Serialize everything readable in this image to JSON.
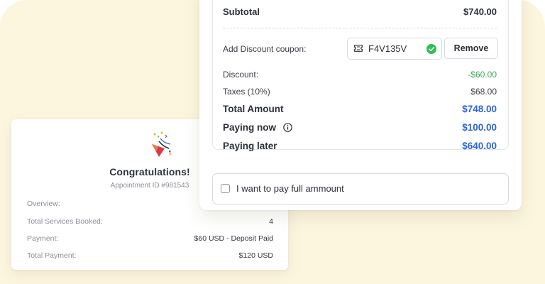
{
  "congrats": {
    "icon": "party-popper-icon",
    "title": "Congratulations!",
    "appointment_id": "Appointment ID #981543",
    "rows": [
      {
        "label": "Overview:",
        "value": ""
      },
      {
        "label": "Total Services Booked:",
        "value": "4"
      },
      {
        "label": "Payment:",
        "value": "$60 USD - Deposit Paid"
      },
      {
        "label": "Total Payment:",
        "value": "$120 USD"
      }
    ]
  },
  "checkout": {
    "subtotal": {
      "label": "Subtotal",
      "value": "$740.00"
    },
    "coupon": {
      "label": "Add Discount coupon:",
      "code": "F4V135V",
      "icon": "ticket-icon",
      "status_icon": "check-circle-icon",
      "remove_label": "Remove"
    },
    "discount": {
      "label": "Discount:",
      "value": "-$60.00"
    },
    "taxes": {
      "label": "Taxes (10%)",
      "value": "$68.00"
    },
    "total": {
      "label": "Total Amount",
      "value": "$748.00"
    },
    "paying_now": {
      "label": "Paying now",
      "value": "$100.00",
      "icon": "info-icon"
    },
    "paying_later": {
      "label": "Paying later",
      "value": "$640.00"
    },
    "full_payment": {
      "label": "I want to pay full ammount",
      "checked": false
    }
  },
  "colors": {
    "background": "#fdf6df",
    "accent_blue": "#2c63d9",
    "discount_green": "#3ba55c",
    "success_green": "#2fbf4f"
  }
}
